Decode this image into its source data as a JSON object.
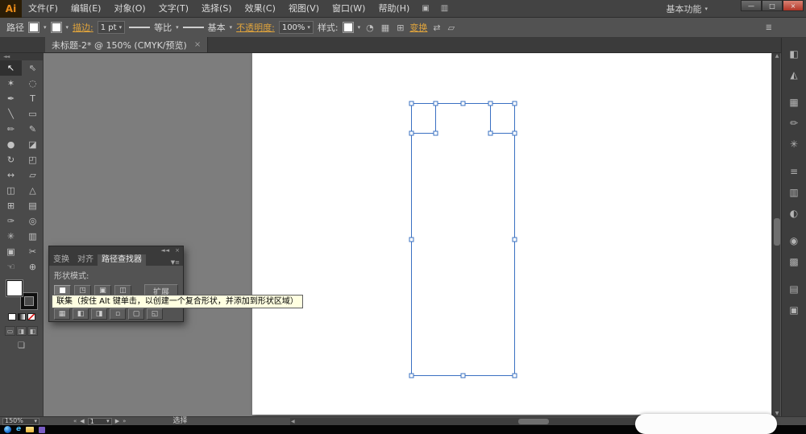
{
  "menubar": {
    "logo": "Ai",
    "items": [
      "文件(F)",
      "编辑(E)",
      "对象(O)",
      "文字(T)",
      "选择(S)",
      "效果(C)",
      "视图(V)",
      "窗口(W)",
      "帮助(H)"
    ],
    "bridge_icon": "▣",
    "arrange_icon": "▥",
    "workspace": "基本功能",
    "workspace_caret": "▾",
    "minimize": "—",
    "restore": "□",
    "close": "×"
  },
  "controlbar": {
    "context": "路径",
    "fill_caret": "▾",
    "stroke_caret": "▾",
    "stroke_label": "描边:",
    "stroke_weight": "1 pt",
    "weight_caret": "▾",
    "profile": "等比",
    "profile_caret": "▾",
    "brush": "基本",
    "brush_caret": "▾",
    "opacity_label": "不透明度:",
    "opacity": "100%",
    "opacity_caret": "▾",
    "style_label": "样式:",
    "style_caret": "▾",
    "recolor_icon": "◔",
    "align_icon": "▦",
    "doc_icon": "⊞",
    "transform": "变换",
    "bbox_icon": "⇄",
    "iso_icon": "▱",
    "panel_menu_icon": "≣"
  },
  "doc_tab": {
    "title": "未标题-2* @ 150% (CMYK/预览)",
    "close": "×"
  },
  "toolbar": {
    "collapse_icon": "◄◄",
    "draw_modes": [
      "▭",
      "◨",
      "◧"
    ],
    "screen_mode_icon": "❏"
  },
  "tools": [
    {
      "name": "selection",
      "glyph": "↖"
    },
    {
      "name": "direct-selection",
      "glyph": "⇖"
    },
    {
      "name": "magic-wand",
      "glyph": "✶"
    },
    {
      "name": "lasso",
      "glyph": "◌"
    },
    {
      "name": "pen",
      "glyph": "✒"
    },
    {
      "name": "type",
      "glyph": "T"
    },
    {
      "name": "line-segment",
      "glyph": "╲"
    },
    {
      "name": "rectangle",
      "glyph": "▭"
    },
    {
      "name": "paintbrush",
      "glyph": "✏"
    },
    {
      "name": "pencil",
      "glyph": "✎"
    },
    {
      "name": "blob-brush",
      "glyph": "●"
    },
    {
      "name": "eraser",
      "glyph": "◪"
    },
    {
      "name": "rotate",
      "glyph": "↻"
    },
    {
      "name": "scale",
      "glyph": "◰"
    },
    {
      "name": "width",
      "glyph": "↔"
    },
    {
      "name": "free-transform",
      "glyph": "▱"
    },
    {
      "name": "shape-builder",
      "glyph": "◫"
    },
    {
      "name": "perspective-grid",
      "glyph": "△"
    },
    {
      "name": "mesh",
      "glyph": "⊞"
    },
    {
      "name": "gradient",
      "glyph": "▤"
    },
    {
      "name": "eyedropper",
      "glyph": "✑"
    },
    {
      "name": "blend",
      "glyph": "◎"
    },
    {
      "name": "symbol-sprayer",
      "glyph": "✳"
    },
    {
      "name": "column-graph",
      "glyph": "▥"
    },
    {
      "name": "artboard",
      "glyph": "▣"
    },
    {
      "name": "slice",
      "glyph": "✂"
    },
    {
      "name": "hand",
      "glyph": "☜"
    },
    {
      "name": "zoom",
      "glyph": "⊕"
    }
  ],
  "pathfinder": {
    "collapse_icon": "◄◄",
    "close_icon": "×",
    "menu_icon": "▼≡",
    "tabs": [
      "变换",
      "对齐",
      "路径查找器"
    ],
    "shape_modes_label": "形状模式:",
    "shape_buttons": [
      {
        "name": "unite",
        "glyph": "■"
      },
      {
        "name": "minus-front",
        "glyph": "◳"
      },
      {
        "name": "intersect",
        "glyph": "▣"
      },
      {
        "name": "exclude",
        "glyph": "◫"
      }
    ],
    "expand": "扩展",
    "pathfinder_buttons": [
      {
        "name": "divide",
        "glyph": "▦"
      },
      {
        "name": "trim",
        "glyph": "◧"
      },
      {
        "name": "merge",
        "glyph": "◨"
      },
      {
        "name": "crop",
        "glyph": "▫"
      },
      {
        "name": "outline",
        "glyph": "▢"
      },
      {
        "name": "minus-back",
        "glyph": "◱"
      }
    ]
  },
  "tooltip": "联集（按住 Alt 键单击，以创建一个复合形状，并添加到形状区域）",
  "dock_icons": [
    {
      "name": "color-panel",
      "glyph": "◧"
    },
    {
      "name": "color-guide-panel",
      "glyph": "◭"
    },
    {
      "name": "swatches-panel",
      "glyph": "▦"
    },
    {
      "name": "brushes-panel",
      "glyph": "✏"
    },
    {
      "name": "symbols-panel",
      "glyph": "✳"
    },
    {
      "name": "stroke-panel",
      "glyph": "≡"
    },
    {
      "name": "gradient-panel",
      "glyph": "▥"
    },
    {
      "name": "transparency-panel",
      "glyph": "◐"
    },
    {
      "name": "appearance-panel",
      "glyph": "◉"
    },
    {
      "name": "graphic-styles-panel",
      "glyph": "▩"
    },
    {
      "name": "layers-panel",
      "glyph": "▤"
    },
    {
      "name": "artboards-panel",
      "glyph": "▣"
    }
  ],
  "scroll": {
    "up": "▲",
    "down": "▼",
    "left": "◀",
    "right": "▶"
  },
  "statusbar": {
    "zoom": "150%",
    "zoom_caret": "▾",
    "nav_first": "«",
    "nav_prev": "◀",
    "artboard_number": "1",
    "artboard_caret": "▾",
    "nav_next": "▶",
    "nav_last": "»",
    "status": "选择"
  },
  "taskbar": {
    "ie": "e"
  },
  "colors": {
    "selection_blue": "#3a70c2",
    "link_orange": "#e0a43c",
    "artboard_white": "#ffffff"
  }
}
